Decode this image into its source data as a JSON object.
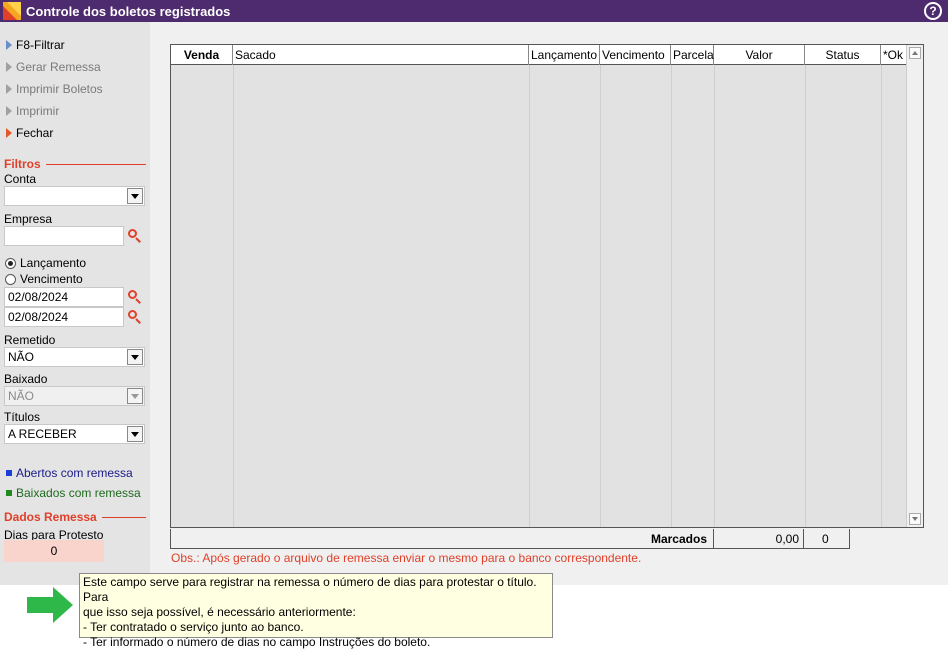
{
  "window": {
    "title": "Controle dos boletos registrados",
    "help_label": "?"
  },
  "menu": [
    {
      "label": "F8-Filtrar",
      "state": "enabled"
    },
    {
      "label": "Gerar Remessa",
      "state": "disabled"
    },
    {
      "label": "Imprimir Boletos",
      "state": "disabled"
    },
    {
      "label": "Imprimir",
      "state": "disabled"
    },
    {
      "label": "Fechar",
      "state": "close"
    }
  ],
  "filters": {
    "section_label": "Filtros",
    "conta_label": "Conta",
    "conta_value": "",
    "empresa_label": "Empresa",
    "empresa_value": "",
    "radio_lancamento": "Lançamento",
    "radio_vencimento": "Vencimento",
    "date_from": "02/08/2024",
    "date_to": "02/08/2024",
    "remetido_label": "Remetido",
    "remetido_value": "NÃO",
    "baixado_label": "Baixado",
    "baixado_value": "NÃO",
    "titulos_label": "Títulos",
    "titulos_value": "A RECEBER"
  },
  "legend": [
    {
      "label": "Abertos com remessa",
      "color": "#1a3fd6",
      "text_color": "#1a1a8a"
    },
    {
      "label": "Baixados com remessa",
      "color": "#1f8a1f",
      "text_color": "#1f6a1f"
    }
  ],
  "remessa": {
    "section_label": "Dados Remessa",
    "dias_label": "Dias para Protesto",
    "dias_value": "0"
  },
  "grid": {
    "columns": [
      "Venda",
      "Sacado",
      "Lançamento",
      "Vencimento",
      "Parcela",
      "Valor",
      "Status",
      "*Ok"
    ],
    "rows": []
  },
  "totals": {
    "label": "Marcados",
    "value": "0,00",
    "count": "0"
  },
  "obs": "Obs.: Após gerado o arquivo de remessa enviar o mesmo para o banco correspondente.",
  "tooltip": {
    "lines": [
      "Este campo serve para registrar na remessa o número de dias para protestar o título. Para",
      "que isso seja possível, é necessário anteriormente:",
      "- Ter contratado o serviço junto ao banco.",
      "- Ter informado o número de dias no campo Instruções do boleto."
    ]
  },
  "colors": {
    "title_bar": "#4e2a6e",
    "accent": "#e0402a",
    "protest_field": "#f9d4cc",
    "tooltip_bg": "#ffffe1",
    "arrow": "#2eb84a"
  }
}
